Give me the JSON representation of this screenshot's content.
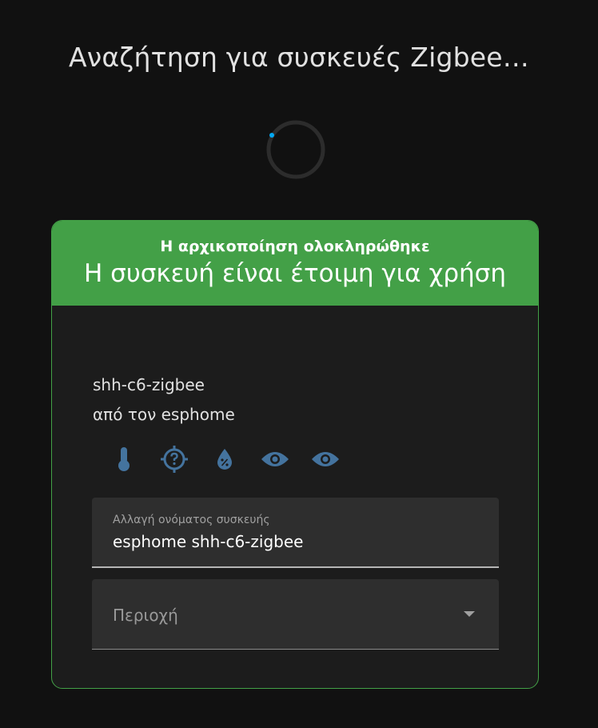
{
  "page": {
    "title": "Αναζήτηση για συσκευές Zigbee…"
  },
  "card": {
    "subtitle": "Η αρχικοποίηση ολοκληρώθηκε",
    "title": "Η συσκευή είναι έτοιμη για χρήση",
    "device_name": "shh-c6-zigbee",
    "device_maker": "από τον esphome",
    "entity_icons": [
      "thermometer-icon",
      "crosshairs-question-icon",
      "water-percent-icon",
      "eye-icon",
      "eye-icon"
    ],
    "name_field": {
      "label": "Αλλαγή ονόματος συσκευής",
      "value": "esphome shh-c6-zigbee"
    },
    "area_field": {
      "placeholder": "Περιοχή"
    }
  },
  "colors": {
    "success": "#43a047",
    "icon": "#44739e",
    "spinner_accent": "#03a9f4",
    "background": "#111111",
    "card_background": "#1c1c1c"
  }
}
